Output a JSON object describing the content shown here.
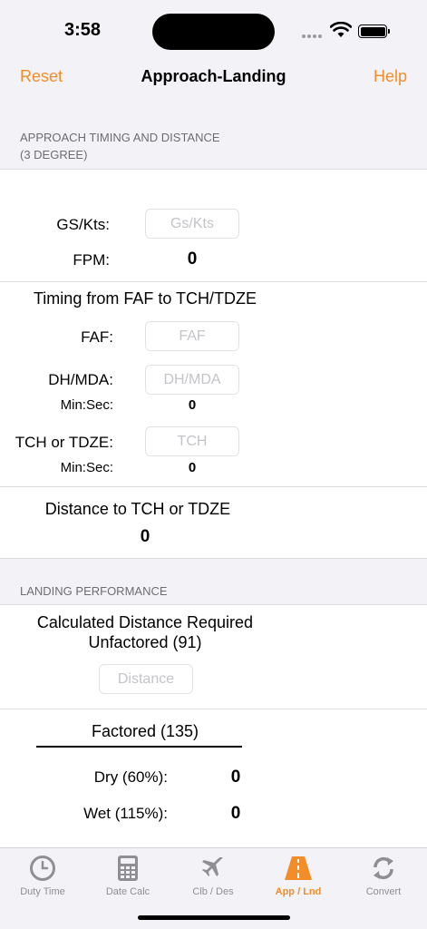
{
  "status": {
    "time": "3:58"
  },
  "nav": {
    "left": "Reset",
    "title": "Approach-Landing",
    "right": "Help"
  },
  "approach": {
    "header_line1": "APPROACH TIMING AND DISTANCE",
    "header_line2": "(3 DEGREE)",
    "gs_label": "GS/Kts:",
    "gs_placeholder": "Gs/Kts",
    "fpm_label": "FPM:",
    "fpm_value": "0",
    "timing_title": "Timing from FAF to TCH/TDZE",
    "faf_label": "FAF:",
    "faf_placeholder": "FAF",
    "dh_label": "DH/MDA:",
    "dh_placeholder": "DH/MDA",
    "dh_minsec_label": "Min:Sec:",
    "dh_minsec_value": "0",
    "tch_label": "TCH or TDZE:",
    "tch_placeholder": "TCH",
    "tch_minsec_label": "Min:Sec:",
    "tch_minsec_value": "0",
    "distance_title": "Distance to TCH or TDZE",
    "distance_value": "0"
  },
  "landing": {
    "header": "LANDING PERFORMANCE",
    "calc_line1": "Calculated Distance Required",
    "calc_line2": "Unfactored (91)",
    "distance_placeholder": "Distance",
    "factored_title": "Factored (135)",
    "dry_label": "Dry (60%):",
    "dry_value": "0",
    "wet_label": "Wet (115%):",
    "wet_value": "0"
  },
  "tabs": [
    {
      "label": "Duty Time",
      "icon": "clock-icon"
    },
    {
      "label": "Date Calc",
      "icon": "calculator-icon"
    },
    {
      "label": "Clb / Des",
      "icon": "airplane-icon"
    },
    {
      "label": "App / Lnd",
      "icon": "runway-icon"
    },
    {
      "label": "Convert",
      "icon": "convert-arrows-icon"
    }
  ],
  "colors": {
    "accent": "#f28d2a",
    "inactive": "#8e8e93"
  }
}
